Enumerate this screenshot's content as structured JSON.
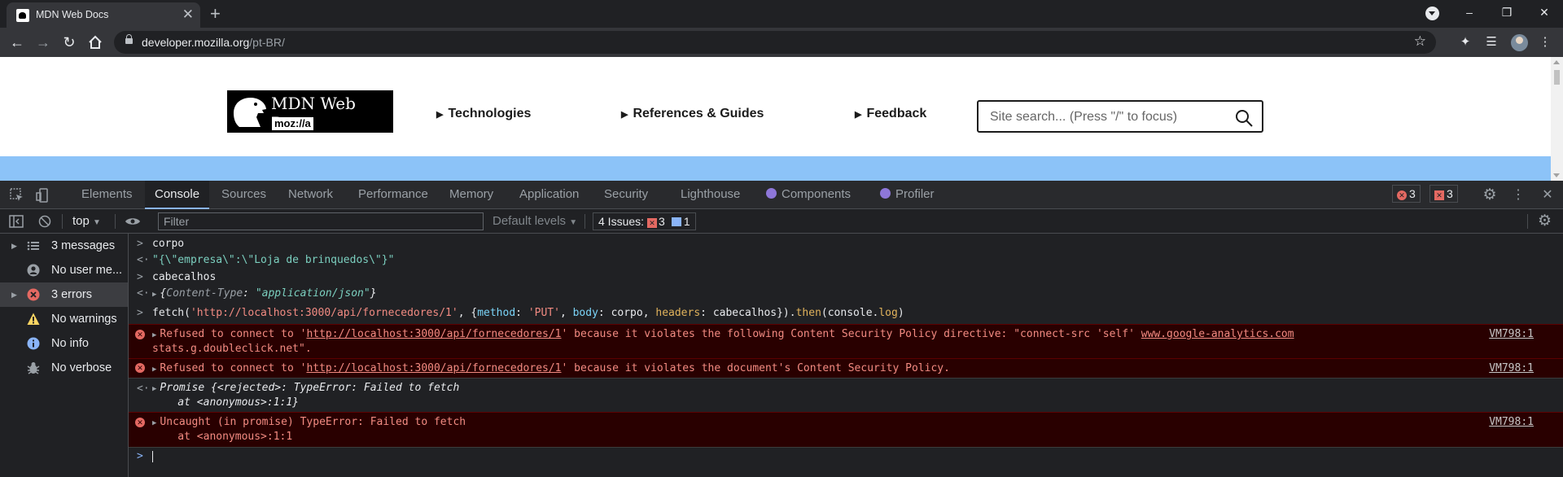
{
  "browser": {
    "tab_title": "MDN Web Docs",
    "tab_close": "✕",
    "new_tab": "+",
    "url_host": "developer.mozilla.org",
    "url_path": "/pt-BR/",
    "window": {
      "minimize": "–",
      "maximize": "❐",
      "close": "✕"
    }
  },
  "page": {
    "logo_name": "MDN Web Docs",
    "logo_sub": "moz://a",
    "nav": [
      "Technologies",
      "References & Guides",
      "Feedback"
    ],
    "search_placeholder": "Site search... (Press \"/\" to focus)",
    "band_color": "#8cc3f8"
  },
  "devtools": {
    "tabs": [
      "Elements",
      "Console",
      "Sources",
      "Network",
      "Performance",
      "Memory",
      "Application",
      "Security",
      "Lighthouse",
      "Components",
      "Profiler"
    ],
    "active_tab": "Console",
    "error_count_a": "3",
    "error_count_b": "3",
    "context": "top",
    "filter_placeholder": "Filter",
    "levels": "Default levels",
    "issues_label": "4 Issues:",
    "issues_errors": "3",
    "issues_info": "1",
    "sidebar": [
      {
        "label": "3 messages",
        "icon": "list-icon"
      },
      {
        "label": "No user me...",
        "icon": "user-icon"
      },
      {
        "label": "3 errors",
        "icon": "error-icon"
      },
      {
        "label": "No warnings",
        "icon": "warning-icon"
      },
      {
        "label": "No info",
        "icon": "info-icon"
      },
      {
        "label": "No verbose",
        "icon": "bug-icon"
      }
    ],
    "console": {
      "l1": "corpo",
      "l2": "\"{\\\"empresa\\\":\\\"Loja de brinquedos\\\"}\"",
      "l3": "cabecalhos",
      "l4_key": "Content-Type",
      "l4_val": "\"application/json\"",
      "l5_fetch": "fetch(",
      "l5_url": "'http://localhost:3000/api/fornecedores/1'",
      "l5_rest_a": ", {",
      "l5_method_k": "method",
      "l5_method_v": "'PUT'",
      "l5_body_k": "body",
      "l5_body_v": "corpo",
      "l5_headers_k": "headers",
      "l5_headers_v": "cabecalhos",
      "l5_tail_a": "}).",
      "l5_then": "then",
      "l5_tail_b": "(console.",
      "l5_log": "log",
      "l5_tail_c": ")",
      "e1_a": "Refused to connect to '",
      "e1_link": "http://localhost:3000/api/fornecedores/1",
      "e1_b": "' because it violates the following Content Security Policy directive: \"connect-src 'self' ",
      "e1_link2": "www.google-analytics.com",
      "e1_c": "stats.g.doubleclick.net\".",
      "e1_src": "VM798:1",
      "e2_a": "Refused to connect to '",
      "e2_link": "http://localhost:3000/api/fornecedores/1",
      "e2_b": "' because it violates the document's Content Security Policy.",
      "e2_src": "VM798:1",
      "p1": "Promise {<rejected>: TypeError: Failed to fetch",
      "p2": "    at <anonymous>:1:1}",
      "e3_a": "Uncaught (in promise) TypeError: Failed to fetch",
      "e3_b": "    at <anonymous>:1:1",
      "e3_src": "VM798:1"
    }
  }
}
